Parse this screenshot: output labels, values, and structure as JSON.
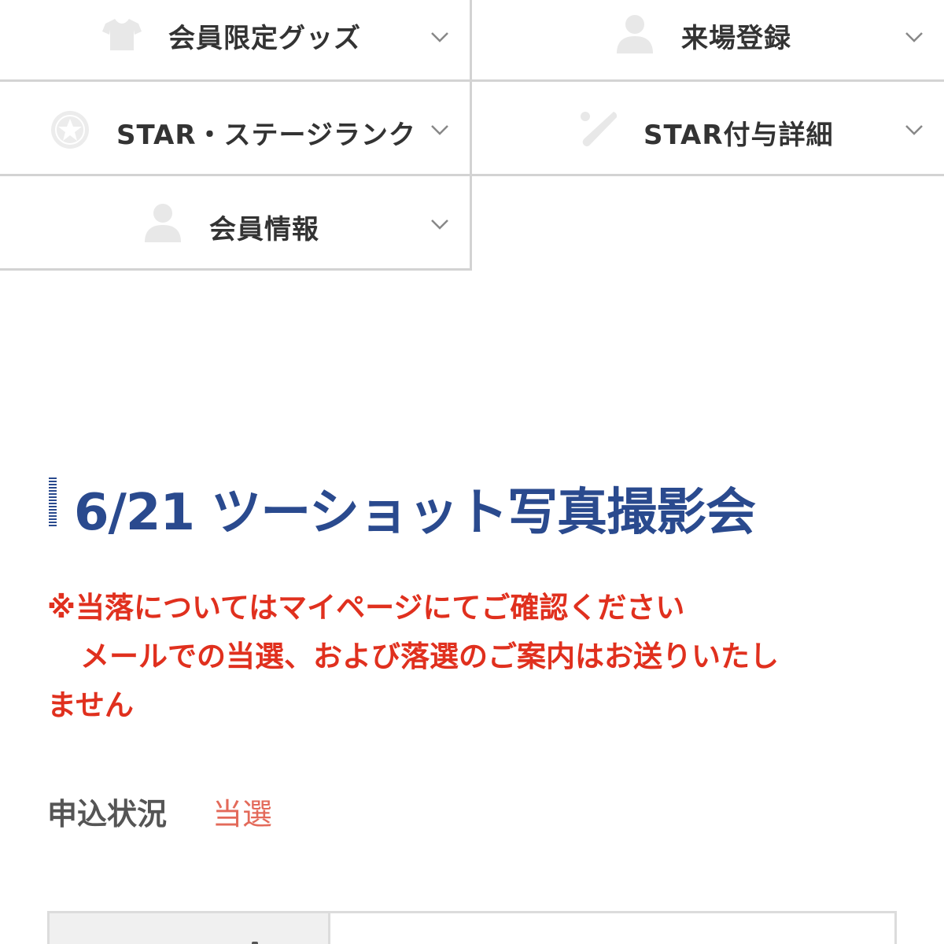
{
  "menu": {
    "items": [
      {
        "label": "会員限定グッズ",
        "icon": "tshirt-icon"
      },
      {
        "label": "来場登録",
        "icon": "person-icon"
      },
      {
        "label": "STAR・ステージランク",
        "icon": "star-medal-icon"
      },
      {
        "label": "STAR付与詳細",
        "icon": "baseball-bat-icon"
      },
      {
        "label": "会員情報",
        "icon": "person-icon"
      }
    ]
  },
  "event": {
    "title": "6/21 ツーショット写真撮影会"
  },
  "notice": {
    "line1": "※当落についてはマイページにてご確認ください",
    "line2": "メールでの当選、および落選のご案内はお送りいたし",
    "line3": "ません"
  },
  "application": {
    "status_label": "申込状況",
    "status_value": "当選"
  },
  "colors": {
    "heading": "#2a4a8e",
    "notice": "#e0301e",
    "status_value": "#e36a5a",
    "icon_gray": "#e8e8e8"
  }
}
